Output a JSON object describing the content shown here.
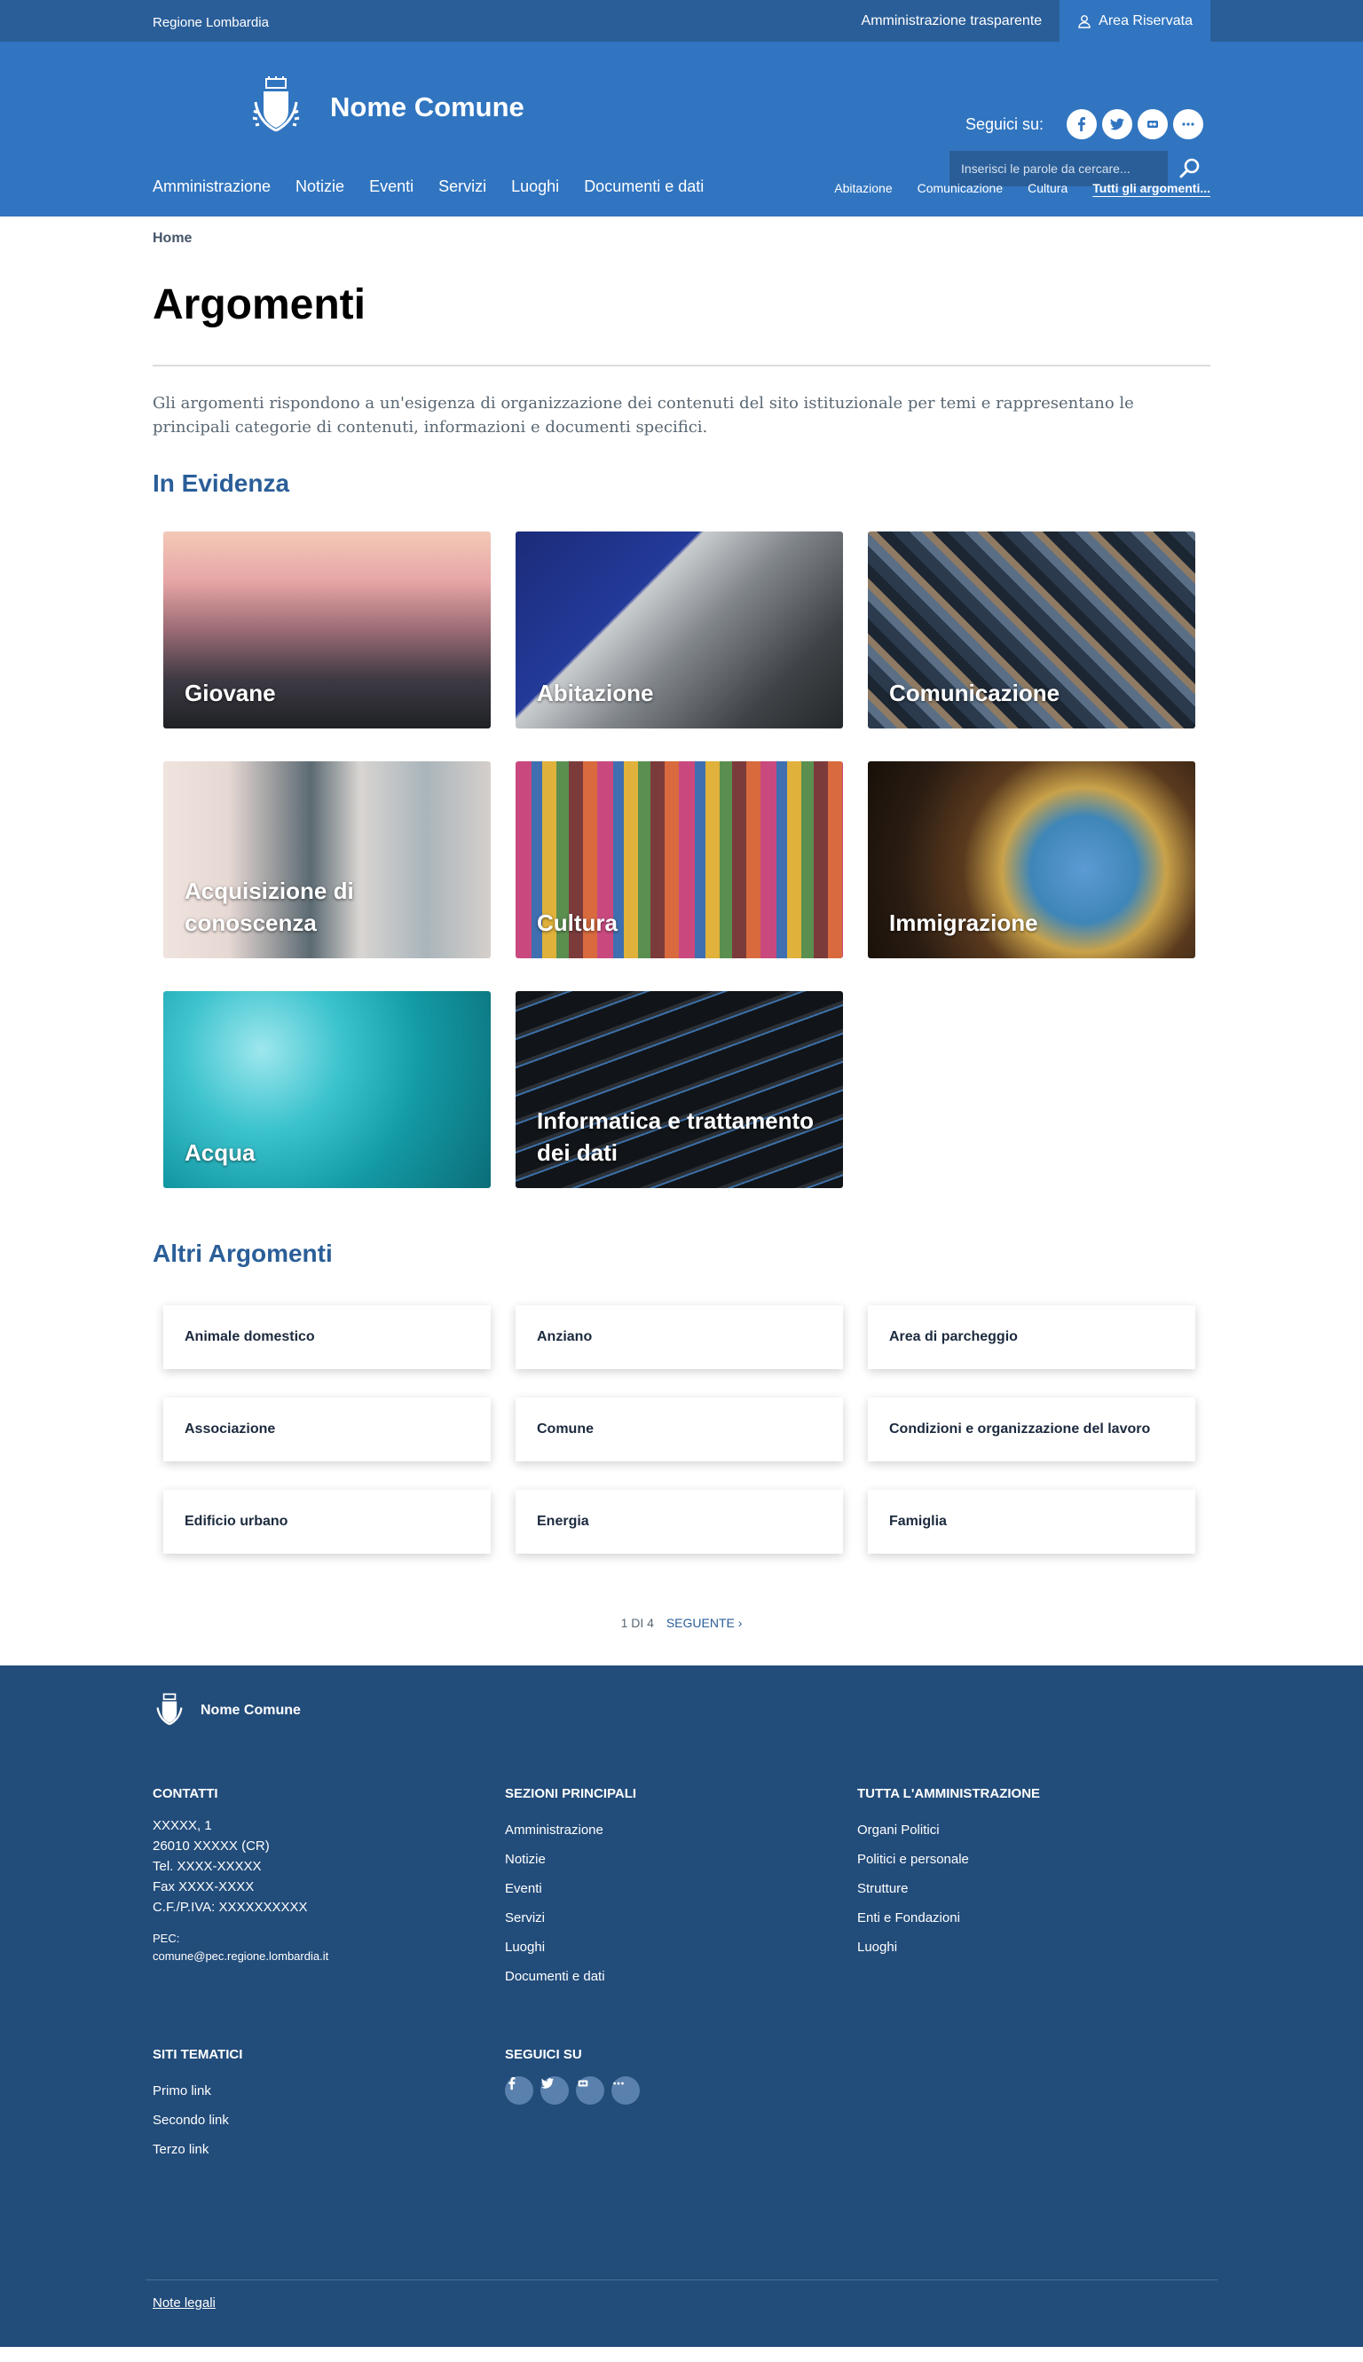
{
  "topbar": {
    "region": "Regione Lombardia",
    "amministrazione": "Amministrazione trasparente",
    "area_riservata": "Area Riservata"
  },
  "header": {
    "site_name": "Nome Comune",
    "social_label": "Seguici su:",
    "search_placeholder": "Inserisci le parole da cercare...",
    "nav": [
      "Amministrazione",
      "Notizie",
      "Eventi",
      "Servizi",
      "Luoghi",
      "Documenti e dati"
    ],
    "nav_topics": [
      "Abitazione",
      "Comunicazione",
      "Cultura"
    ],
    "nav_all_topics": "Tutti gli argomenti..."
  },
  "breadcrumb": "Home",
  "page_title": "Argomenti",
  "intro": "Gli argomenti rispondono a un'esigenza di organizzazione dei contenuti del sito istituzionale per temi e rappresentano le principali categorie di contenuti, informazioni e documenti specifici.",
  "evidenza": {
    "title": "In Evidenza",
    "cards": [
      "Giovane",
      "Abitazione",
      "Comunicazione",
      "Acquisizione di conoscenza",
      "Cultura",
      "Immigrazione",
      "Acqua",
      "Informatica e trattamento dei dati"
    ]
  },
  "altri": {
    "title": "Altri Argomenti",
    "items": [
      "Animale domestico",
      "Anziano",
      "Area di parcheggio",
      "Associazione",
      "Comune",
      "Condizioni e organizzazione del lavoro",
      "Edificio urbano",
      "Energia",
      "Famiglia"
    ]
  },
  "pager": {
    "status": "1 DI 4",
    "next": "SEGUENTE ›"
  },
  "footer": {
    "site_name": "Nome Comune",
    "contatti": {
      "title": "CONTATTI",
      "lines": [
        "XXXXX, 1",
        "26010 XXXXX (CR)",
        "Tel. XXXX-XXXXX",
        "Fax XXXX-XXXX",
        "C.F./P.IVA: XXXXXXXXXX"
      ],
      "pec_label": "PEC:",
      "pec": "comune@pec.regione.lombardia.it"
    },
    "sezioni": {
      "title": "SEZIONI PRINCIPALI",
      "links": [
        "Amministrazione",
        "Notizie",
        "Eventi",
        "Servizi",
        "Luoghi",
        "Documenti e dati"
      ]
    },
    "amministrazione": {
      "title": "TUTTA L'AMMINISTRAZIONE",
      "links": [
        "Organi Politici",
        "Politici e personale",
        "Strutture",
        "Enti e Fondazioni",
        "Luoghi"
      ]
    },
    "siti": {
      "title": "SITI TEMATICI",
      "links": [
        "Primo link",
        "Secondo link",
        "Terzo link"
      ]
    },
    "seguici": {
      "title": "SEGUICI SU"
    },
    "legal": "Note legali"
  },
  "colors": {
    "topbar": "#2a5e98",
    "header": "#3175c0",
    "accent": "#2a5e98",
    "footer": "#224c7a"
  },
  "icons": [
    "user-icon",
    "coat-of-arms-icon",
    "facebook-icon",
    "twitter-icon",
    "flickr-icon",
    "more-icon",
    "search-icon"
  ]
}
